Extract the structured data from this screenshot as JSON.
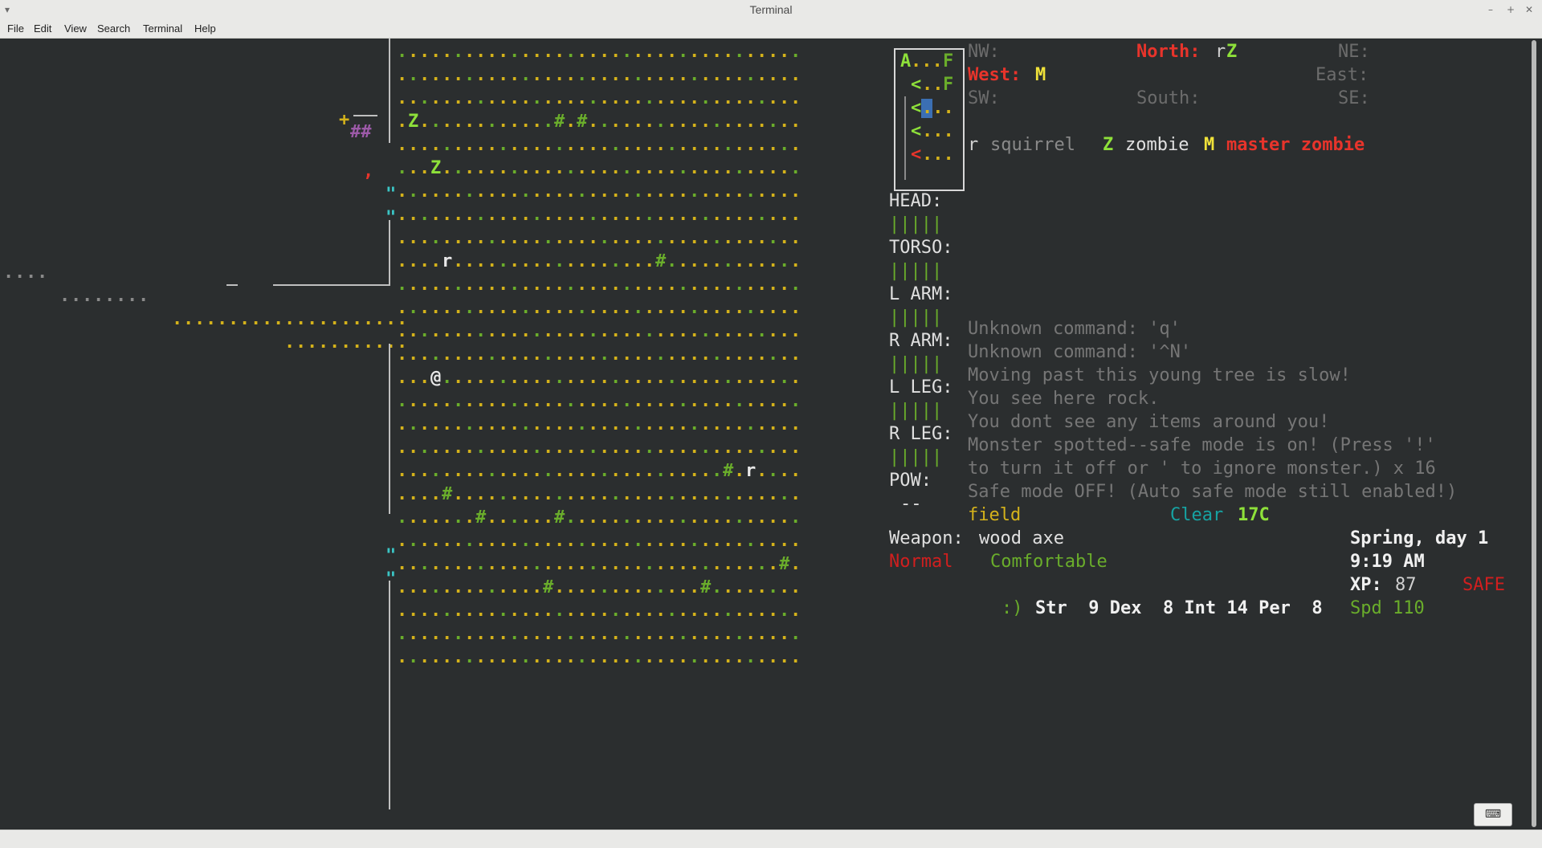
{
  "window": {
    "title": "Terminal"
  },
  "menu": [
    "File",
    "Edit",
    "View",
    "Search",
    "Terminal",
    "Help"
  ],
  "colors": {
    "bg": "#2b2e2f",
    "grass": "#6aad2b",
    "dirt": "#d4b21b",
    "white": "#e8e8e8",
    "gray": "#8a8a8a",
    "red": "#e8342b",
    "yellow": "#f0e23a",
    "lime": "#8ee03a",
    "cyan": "#3bc5c5",
    "teal": "#16a3a3",
    "dim": "#6c6c6c"
  },
  "compass": {
    "nw": "NW:",
    "north_label": "North:",
    "north_r": "r",
    "north_z": "Z",
    "ne": "NE:",
    "west_label": "West:",
    "west_m": "M",
    "east": "East:",
    "sw": "SW:",
    "south": "South:",
    "se": "SE:"
  },
  "monster_legend": {
    "r_glyph": "r",
    "r_name": "squirrel",
    "z_glyph": "Z",
    "z_name": "zombie",
    "m_glyph": "M",
    "m_name": "master zombie"
  },
  "minimap": {
    "rows": [
      "A...F",
      " <..F",
      " <...",
      " <...",
      " <..."
    ]
  },
  "body_parts": {
    "head": "HEAD:",
    "torso": "TORSO:",
    "l_arm": "L ARM:",
    "r_arm": "R ARM:",
    "l_leg": "L LEG:",
    "r_leg": "R LEG:",
    "pow": "POW:",
    "pow_value": "--",
    "health_bar": "|||||"
  },
  "messages": [
    "Unknown command: 'q'",
    "Unknown command: '^N'",
    "Moving past this young tree is slow!",
    "You see here rock.",
    "You dont see any items around you!",
    "Monster spotted--safe mode is on! (Press '!'",
    "to turn it off or ' to ignore monster.) x 16",
    "Safe mode OFF! (Auto safe mode still enabled!)"
  ],
  "status": {
    "terrain": "field",
    "weather": "Clear",
    "temperature": "17C",
    "weapon_label": "Weapon:",
    "weapon": "wood axe",
    "hunger": "Normal",
    "comfort": "Comfortable",
    "date": "Spring, day 1",
    "time": "9:19 AM",
    "xp_label": "XP:",
    "xp": "87",
    "safe": "SAFE",
    "mood": ":)",
    "stats_line": "Str  9 Dex  8 Int 14 Per  8",
    "speed": "Spd 110"
  },
  "map": {
    "player": "@",
    "zombie": "Z",
    "squirrel": "r",
    "tree": "#",
    "grass": ".",
    "door": "\""
  }
}
